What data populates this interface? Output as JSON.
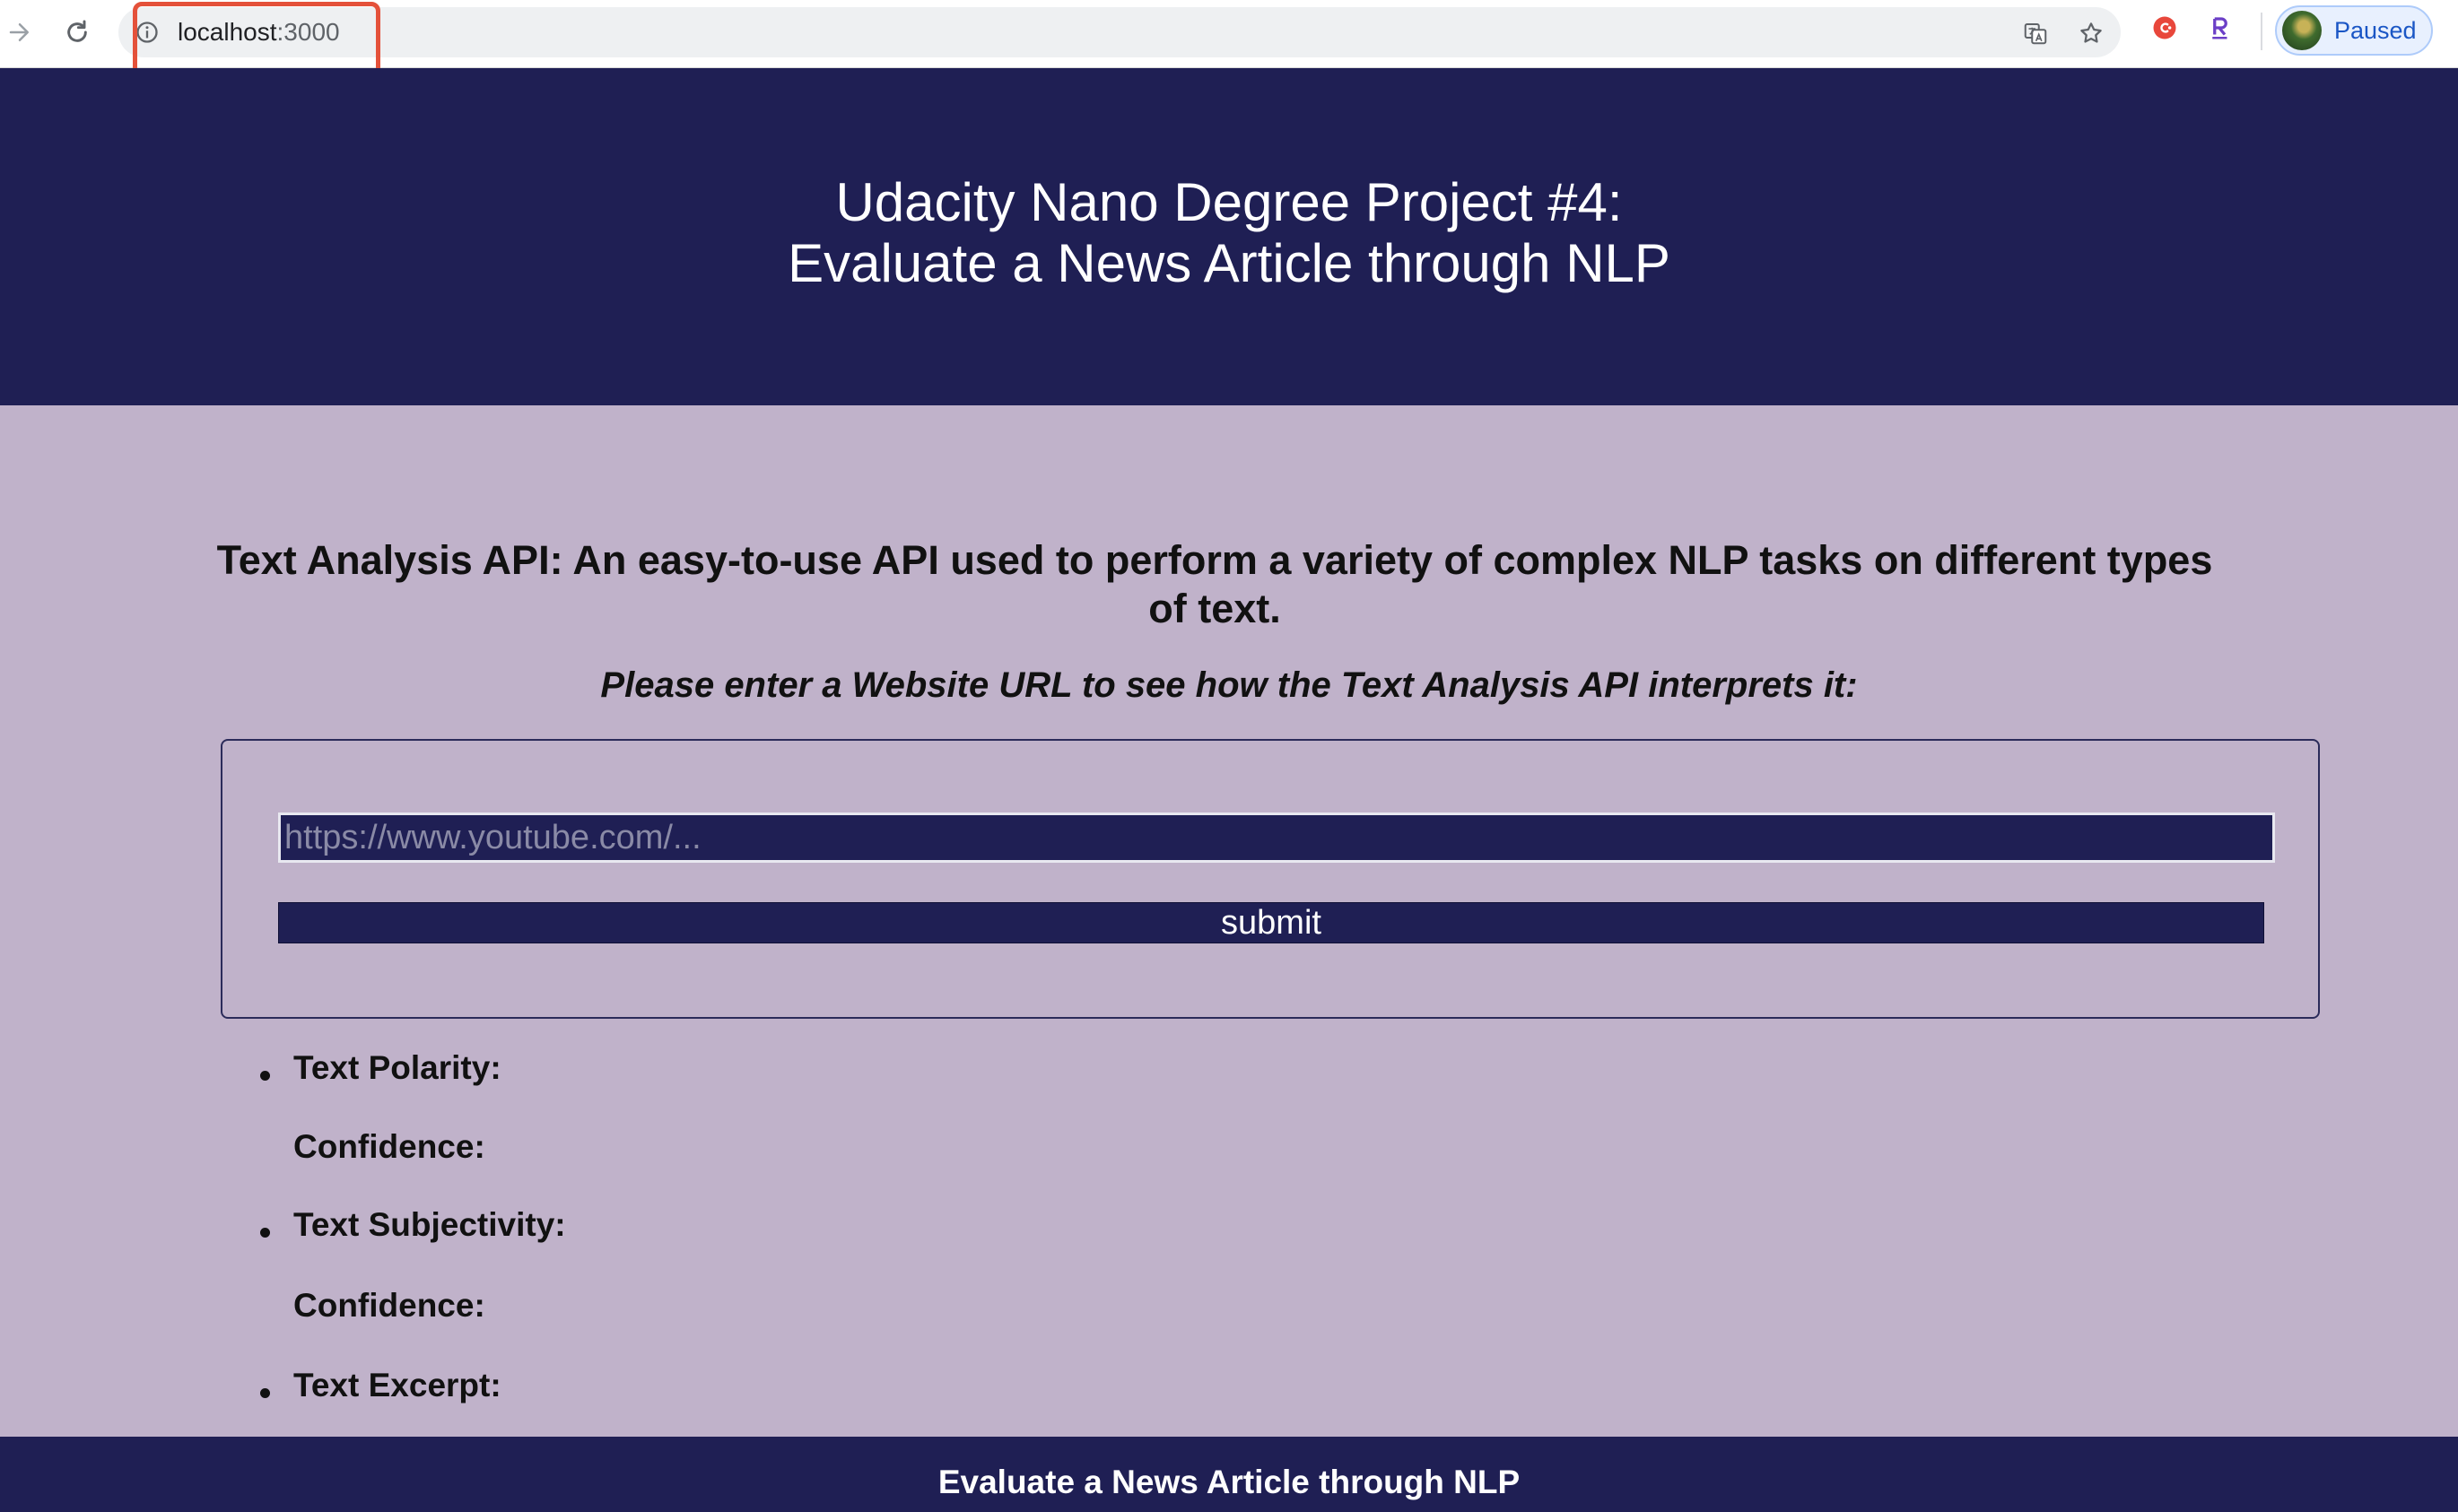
{
  "browser": {
    "url_host": "localhost",
    "url_port": ":3000",
    "profile_label": "Paused"
  },
  "header": {
    "title_line1": "Udacity Nano Degree Project #4:",
    "title_line2": "Evaluate a News Article through NLP"
  },
  "main": {
    "api_title": "Text Analysis API: An easy-to-use API used to perform a variety of complex NLP tasks on different types of text.",
    "prompt": "Please enter a Website URL to see how the Text Analysis API interprets it:",
    "url_input": {
      "placeholder": "https://www.youtube.com/...",
      "value": ""
    },
    "submit_label": "submit"
  },
  "results": {
    "polarity_label": "Text Polarity:",
    "polarity_confidence_label": "Confidence:",
    "subjectivity_label": "Text Subjectivity:",
    "subjectivity_confidence_label": "Confidence:",
    "excerpt_label": "Text Excerpt:"
  },
  "footer": {
    "text": "Evaluate a News Article through NLP"
  }
}
